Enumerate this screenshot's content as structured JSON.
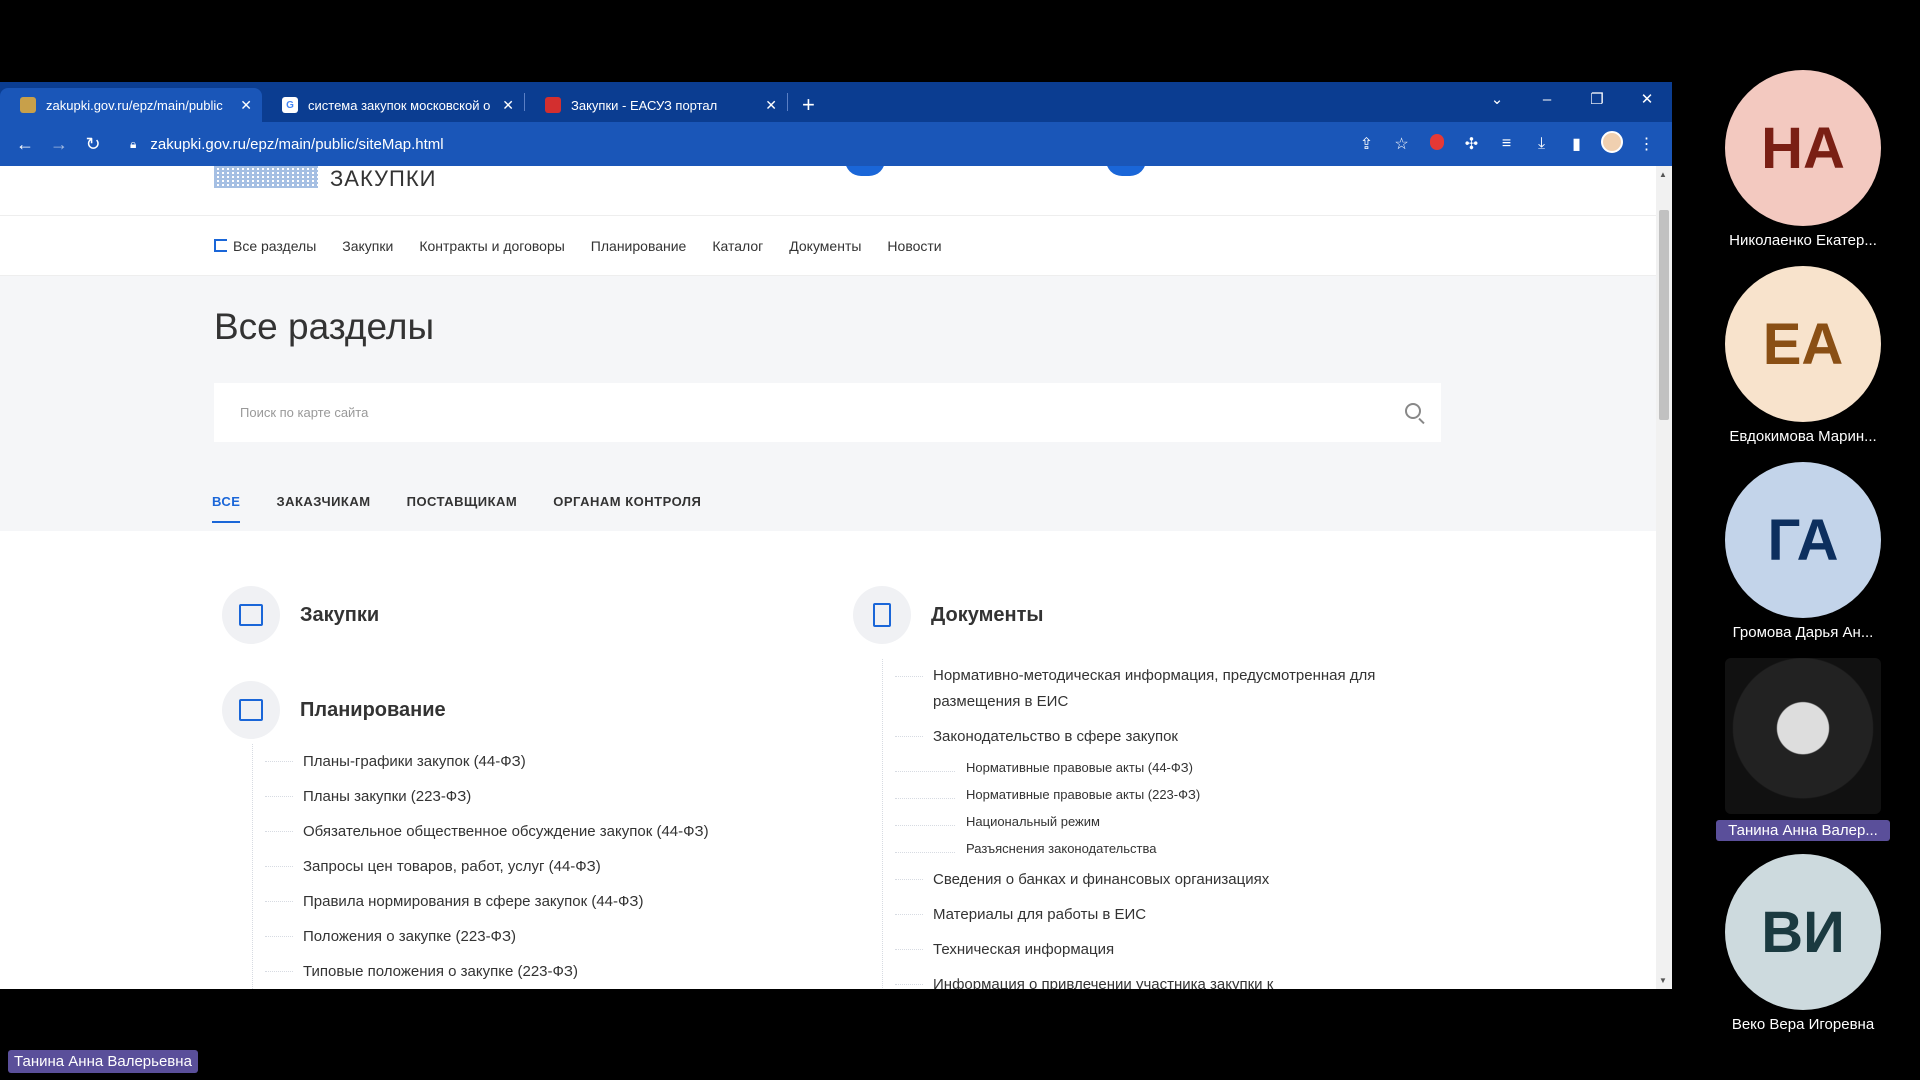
{
  "browser": {
    "tabs": [
      {
        "title": "zakupki.gov.ru/epz/main/public",
        "favicon_color": "#c8a04a",
        "active": true
      },
      {
        "title": "система закупок московской о",
        "favicon_color": "#ffffff",
        "favicon_text": "G",
        "active": false
      },
      {
        "title": "Закупки - ЕАСУЗ портал",
        "favicon_color": "#d32f2f",
        "active": false
      }
    ],
    "new_tab": "+",
    "url": "zakupki.gov.ru/epz/main/public/siteMap.html"
  },
  "site": {
    "logo_text": "ЗАКУПКИ",
    "nav": [
      "Все разделы",
      "Закупки",
      "Контракты и договоры",
      "Планирование",
      "Каталог",
      "Документы",
      "Новости"
    ],
    "page_title": "Все разделы",
    "search_placeholder": "Поиск по карте сайта",
    "filter_tabs": [
      "ВСЕ",
      "ЗАКАЗЧИКАМ",
      "ПОСТАВЩИКАМ",
      "ОРГАНАМ КОНТРОЛЯ"
    ],
    "sections": {
      "zakupki": {
        "title": "Закупки"
      },
      "planning": {
        "title": "Планирование",
        "links": [
          "Планы-графики закупок (44-ФЗ)",
          "Планы закупки (223-ФЗ)",
          "Обязательное общественное обсуждение закупок (44-ФЗ)",
          "Запросы цен товаров, работ, услуг (44-ФЗ)",
          "Правила нормирования в сфере закупок (44-ФЗ)",
          "Положения о закупке (223-ФЗ)",
          "Типовые положения о закупке (223-ФЗ)"
        ]
      },
      "documents": {
        "title": "Документы",
        "link_norm": "Нормативно-методическая информация, предусмотренная для размещения в ЕИС",
        "link_law": "Законодательство в сфере закупок",
        "sub_links": [
          "Нормативные правовые акты (44-ФЗ)",
          "Нормативные правовые акты (223-ФЗ)",
          "Национальный режим",
          "Разъяснения законодательства"
        ],
        "links_after": [
          "Сведения о банках и финансовых организациях",
          "Материалы для работы в ЕИС",
          "Техническая информация",
          "Информация о привлечении участника закупки к"
        ]
      }
    }
  },
  "participants": [
    {
      "initials": "НА",
      "name": "Николаенко Екатер...",
      "bg": "#f3c9c0",
      "fg": "#7a1f14"
    },
    {
      "initials": "ЕА",
      "name": "Евдокимова Марин...",
      "bg": "#f8e3cc",
      "fg": "#8a4f14"
    },
    {
      "initials": "ГА",
      "name": "Громова Дарья Ан...",
      "bg": "#c3d4ea",
      "fg": "#0d2f5e"
    },
    {
      "initials": "",
      "name": "Танина Анна Валер...",
      "photo": true
    },
    {
      "initials": "ВИ",
      "name": "Веко Вера Игоревна",
      "bg": "#cddade",
      "fg": "#1b3a40"
    }
  ],
  "speaker_name": "Танина Анна Валерьевна"
}
